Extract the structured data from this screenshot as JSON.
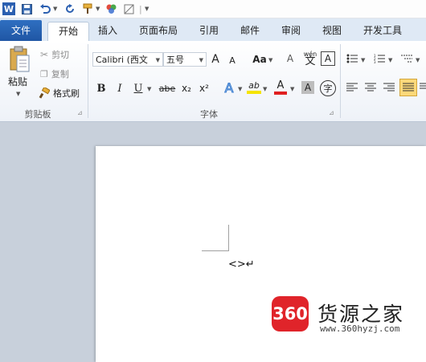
{
  "qat": {
    "icons": [
      "word-app-icon",
      "save-icon",
      "undo-icon",
      "redo-icon",
      "format-painter-icon",
      "color-icon",
      "clear-icon",
      "customize-icon"
    ]
  },
  "tabs": [
    "文件",
    "开始",
    "插入",
    "页面布局",
    "引用",
    "邮件",
    "审阅",
    "视图",
    "开发工具"
  ],
  "clipboard": {
    "paste": "粘贴",
    "cut": "剪切",
    "copy": "复制",
    "format_painter": "格式刷",
    "group_label": "剪贴板"
  },
  "font": {
    "font_name": "Calibri (西文",
    "font_size": "五号",
    "group_label": "字体",
    "btn_bold": "B",
    "btn_italic": "I",
    "btn_underline": "U",
    "btn_strike": "abe",
    "btn_sub": "x₂",
    "btn_sup": "x²",
    "btn_grow": "A",
    "btn_shrink": "A",
    "btn_case": "Aa",
    "btn_text_effect": "A",
    "btn_highlight": "ab",
    "btn_font_color": "A",
    "btn_shade": "A",
    "btn_circle": "字",
    "btn_pinyin": "wén",
    "btn_clear": "A"
  },
  "document": {
    "text": "<>↵"
  },
  "watermark": {
    "badge": "360",
    "name": "货源之家",
    "url": "www.360hyzj.com"
  },
  "colors": {
    "file_tab": "#2a67b8",
    "ribbon_bg": "#f3f6fb",
    "doc_bg": "#c8d0db",
    "font_color_bar": "#e02020",
    "highlight_bar": "#f5e400",
    "badge_red": "#e0242a"
  }
}
